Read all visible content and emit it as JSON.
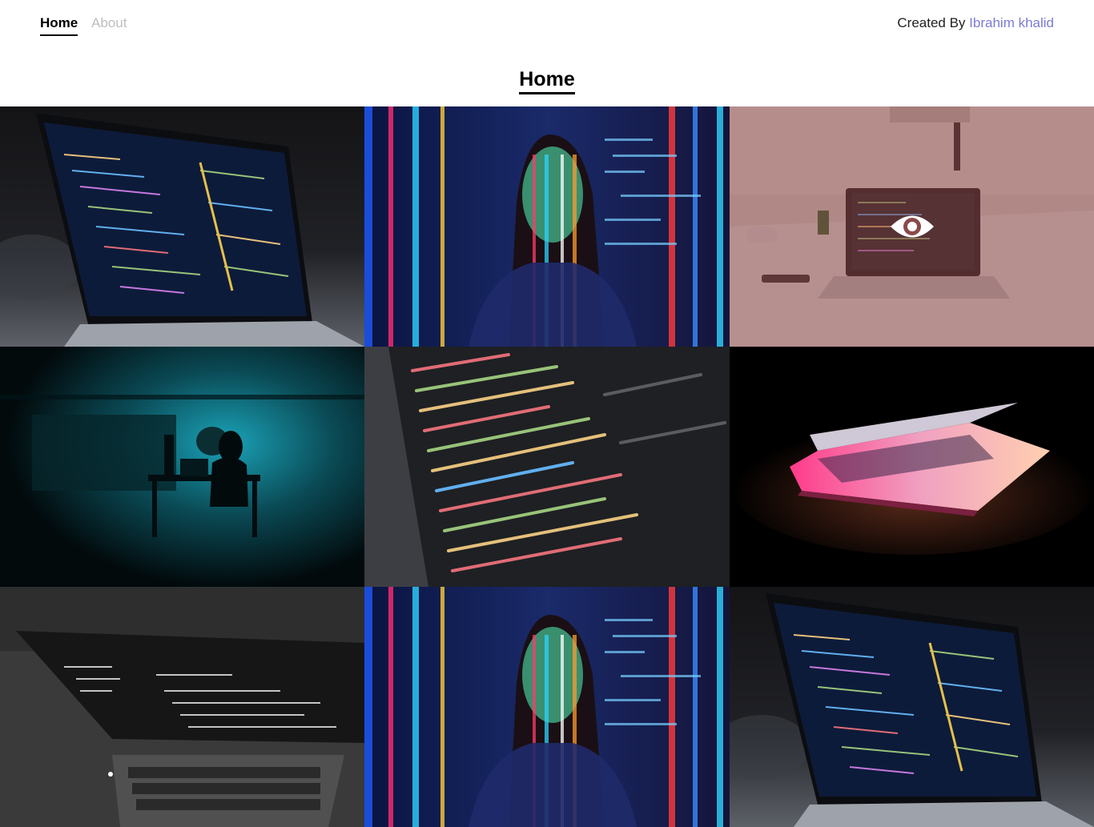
{
  "nav": {
    "home_label": "Home",
    "about_label": "About",
    "credit_prefix": "Created By",
    "credit_author": "Ibrahim khalid"
  },
  "page": {
    "title": "Home"
  },
  "gallery": {
    "hover_icon": "eye-icon",
    "overlay_color": "#823c3c",
    "tiles": [
      {
        "subject": "laptop-code-editor"
      },
      {
        "subject": "woman-code-projection"
      },
      {
        "subject": "laptop-on-desk"
      },
      {
        "subject": "hacker-dark-room"
      },
      {
        "subject": "code-closeup"
      },
      {
        "subject": "glowing-laptop"
      },
      {
        "subject": "laptop-monochrome"
      },
      {
        "subject": "woman-code-projection"
      },
      {
        "subject": "laptop-code-editor"
      }
    ]
  },
  "colors": {
    "accent": "#7b7bd6",
    "muted_link": "#bdbdbd",
    "text": "#000000"
  }
}
